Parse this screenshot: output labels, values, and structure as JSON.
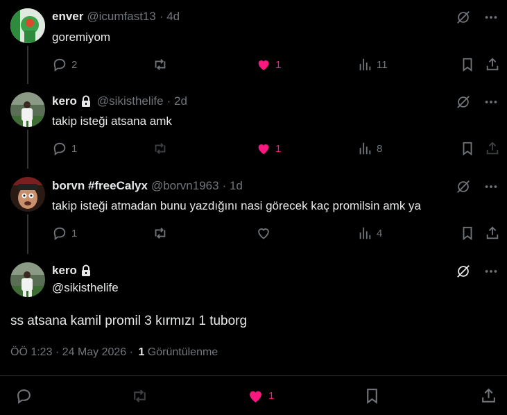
{
  "replies": [
    {
      "name": "enver",
      "handle": "@icumfast13",
      "time": "· 4d",
      "text": "goremiyom",
      "locked": false,
      "reply_count": "2",
      "like_count": "1",
      "liked": true,
      "view_count": "11",
      "retweet_count": ""
    },
    {
      "name": "kero",
      "handle": "@sikisthelife",
      "time": "· 2d",
      "text": "takip isteği atsana amk",
      "locked": true,
      "reply_count": "1",
      "like_count": "1",
      "liked": true,
      "view_count": "8",
      "retweet_count": ""
    },
    {
      "name": "borvn #freeCalyx",
      "handle": "@borvn1963",
      "time": "· 1d",
      "text": "takip isteği atmadan bunu yazdığını nasi görecek kaç promilsin amk ya",
      "locked": false,
      "reply_count": "1",
      "like_count": "",
      "liked": false,
      "view_count": "4",
      "retweet_count": ""
    }
  ],
  "main": {
    "name": "kero",
    "handle": "@sikisthelife",
    "text": "ss atsana kamil promil 3 kırmızı 1 tuborg",
    "timestamp": "ÖÖ 1:23 · 24 May 2026 ·",
    "views_count": "1",
    "views_label": "Görüntülenme",
    "like_count": "1",
    "liked": true
  },
  "colors": {
    "accent_pink": "#f91880",
    "muted": "#71767b",
    "text": "#e7e9ea",
    "background": "#000000"
  },
  "icons": [
    "reply-icon",
    "retweet-icon",
    "like-icon",
    "views-icon",
    "bookmark-icon",
    "share-icon",
    "grok-icon",
    "more-icon",
    "lock-icon"
  ]
}
